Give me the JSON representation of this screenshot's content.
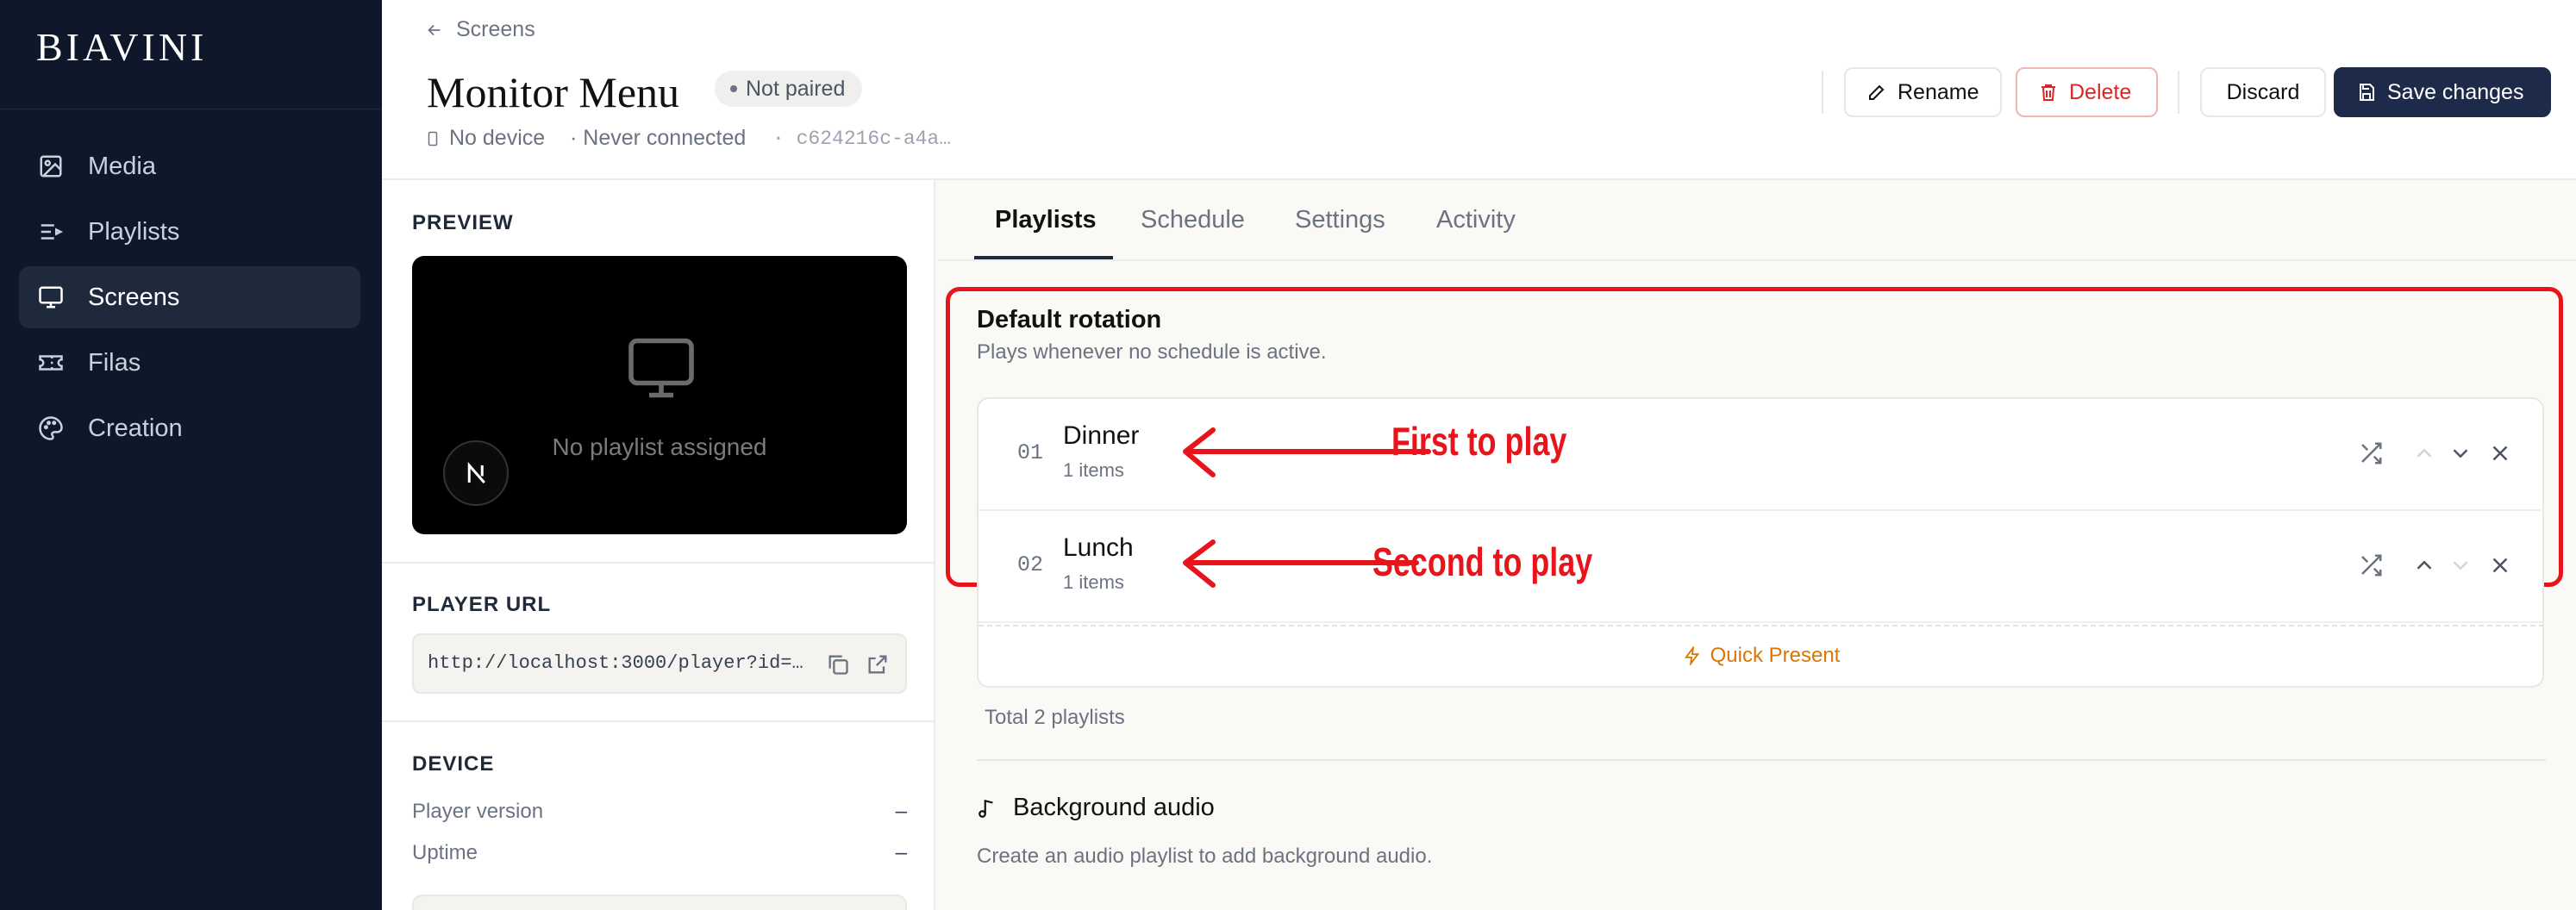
{
  "sidebar": {
    "logo": "BIAVINI",
    "items": [
      {
        "label": "Media",
        "icon": "image-icon"
      },
      {
        "label": "Playlists",
        "icon": "list-icon"
      },
      {
        "label": "Screens",
        "icon": "monitor-icon",
        "active": true
      },
      {
        "label": "Filas",
        "icon": "ticket-icon"
      },
      {
        "label": "Creation",
        "icon": "palette-icon"
      }
    ]
  },
  "header": {
    "breadcrumb": "Screens",
    "title": "Monitor Menu",
    "status_badge": "Not paired",
    "device": "No device",
    "connection": "· Never connected",
    "id": "· c624216c-a4a…",
    "buttons": {
      "rename": "Rename",
      "delete": "Delete",
      "discard": "Discard",
      "save": "Save changes"
    }
  },
  "left_panel": {
    "preview_title": "PREVIEW",
    "preview_empty": "No playlist assigned",
    "player_url_title": "PLAYER URL",
    "player_url": "http://localhost:3000/player?id=…",
    "device_title": "DEVICE",
    "device_rows": [
      {
        "key": "Player version",
        "value": "–"
      },
      {
        "key": "Uptime",
        "value": "–"
      }
    ]
  },
  "main": {
    "tabs": [
      {
        "label": "Playlists",
        "active": true
      },
      {
        "label": "Schedule"
      },
      {
        "label": "Settings"
      },
      {
        "label": "Activity"
      }
    ],
    "rotation": {
      "title": "Default rotation",
      "subtitle": "Plays whenever no schedule is active.",
      "items": [
        {
          "num": "01",
          "name": "Dinner",
          "count": "1 items"
        },
        {
          "num": "02",
          "name": "Lunch",
          "count": "1 items"
        }
      ],
      "quick_present": "Quick Present",
      "total": "Total 2 playlists"
    },
    "audio": {
      "title": "Background audio",
      "hint": "Create an audio playlist to add background audio."
    }
  },
  "annotations": {
    "first": "First to play",
    "second": "Second to play"
  },
  "colors": {
    "accent": "#1e293b",
    "danger": "#dc2626",
    "annotation": "#e8141c",
    "quick": "#d97706"
  }
}
